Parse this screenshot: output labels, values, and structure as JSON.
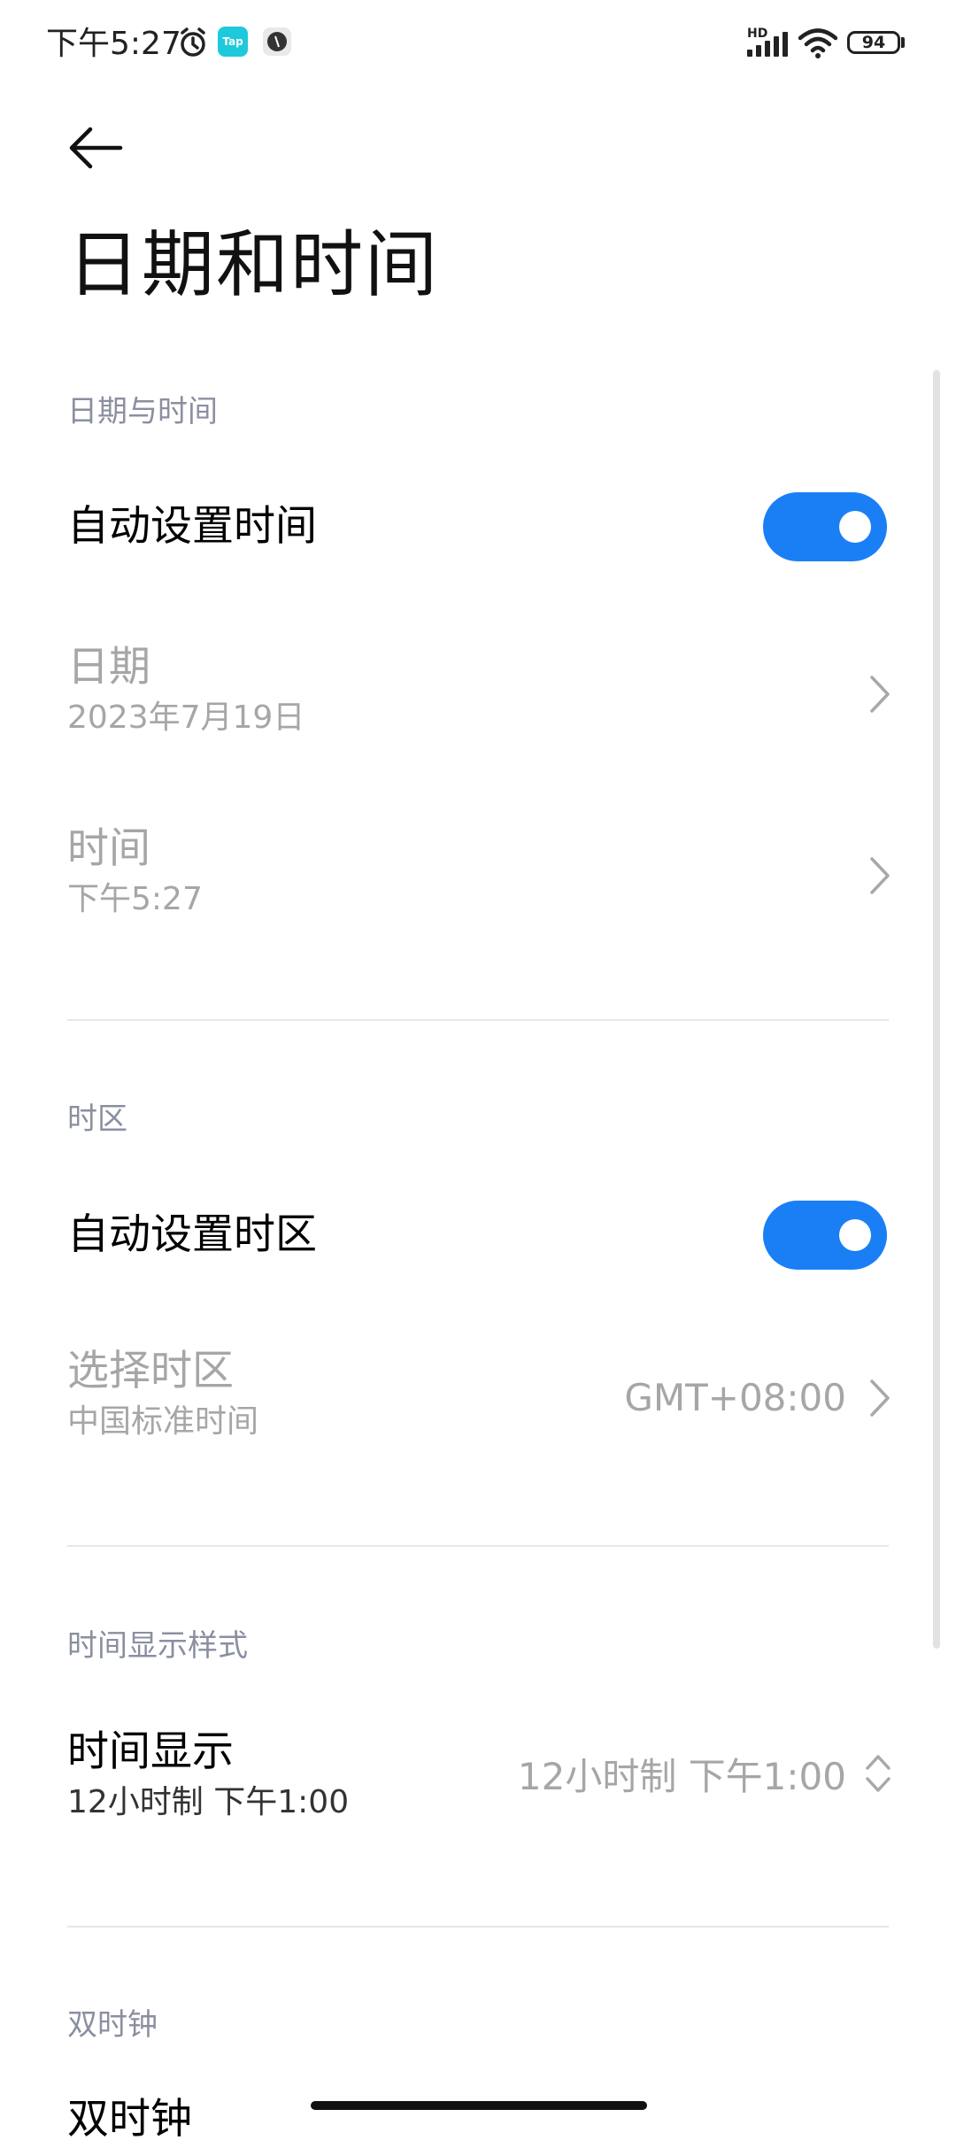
{
  "status_bar": {
    "time": "下午5:27",
    "battery": "94",
    "network": "HD",
    "icons": [
      "alarm-icon",
      "taptap-app-icon",
      "app-notification-icon",
      "hd-signal-icon",
      "wifi-icon",
      "battery-icon"
    ]
  },
  "nav": {
    "back_icon": "back-arrow-icon"
  },
  "page": {
    "title": "日期和时间"
  },
  "sections": {
    "date_time": {
      "header": "日期与时间",
      "auto_time": {
        "label": "自动设置时间",
        "enabled": true
      },
      "date": {
        "label": "日期",
        "value": "2023年7月19日"
      },
      "time": {
        "label": "时间",
        "value": "下午5:27"
      }
    },
    "timezone": {
      "header": "时区",
      "auto_zone": {
        "label": "自动设置时区",
        "enabled": true
      },
      "select_zone": {
        "label": "选择时区",
        "sub": "中国标准时间",
        "value": "GMT+08:00"
      }
    },
    "display_style": {
      "header": "时间显示样式",
      "time_display": {
        "label": "时间显示",
        "sub": "12小时制 下午1:00",
        "value": "12小时制 下午1:00"
      }
    },
    "dual_clock": {
      "header": "双时钟",
      "label": "双时钟"
    }
  },
  "colors": {
    "accent": "#1a7ff5",
    "section_header": "#8a8fa0",
    "disabled_text": "#a6a6a6"
  }
}
